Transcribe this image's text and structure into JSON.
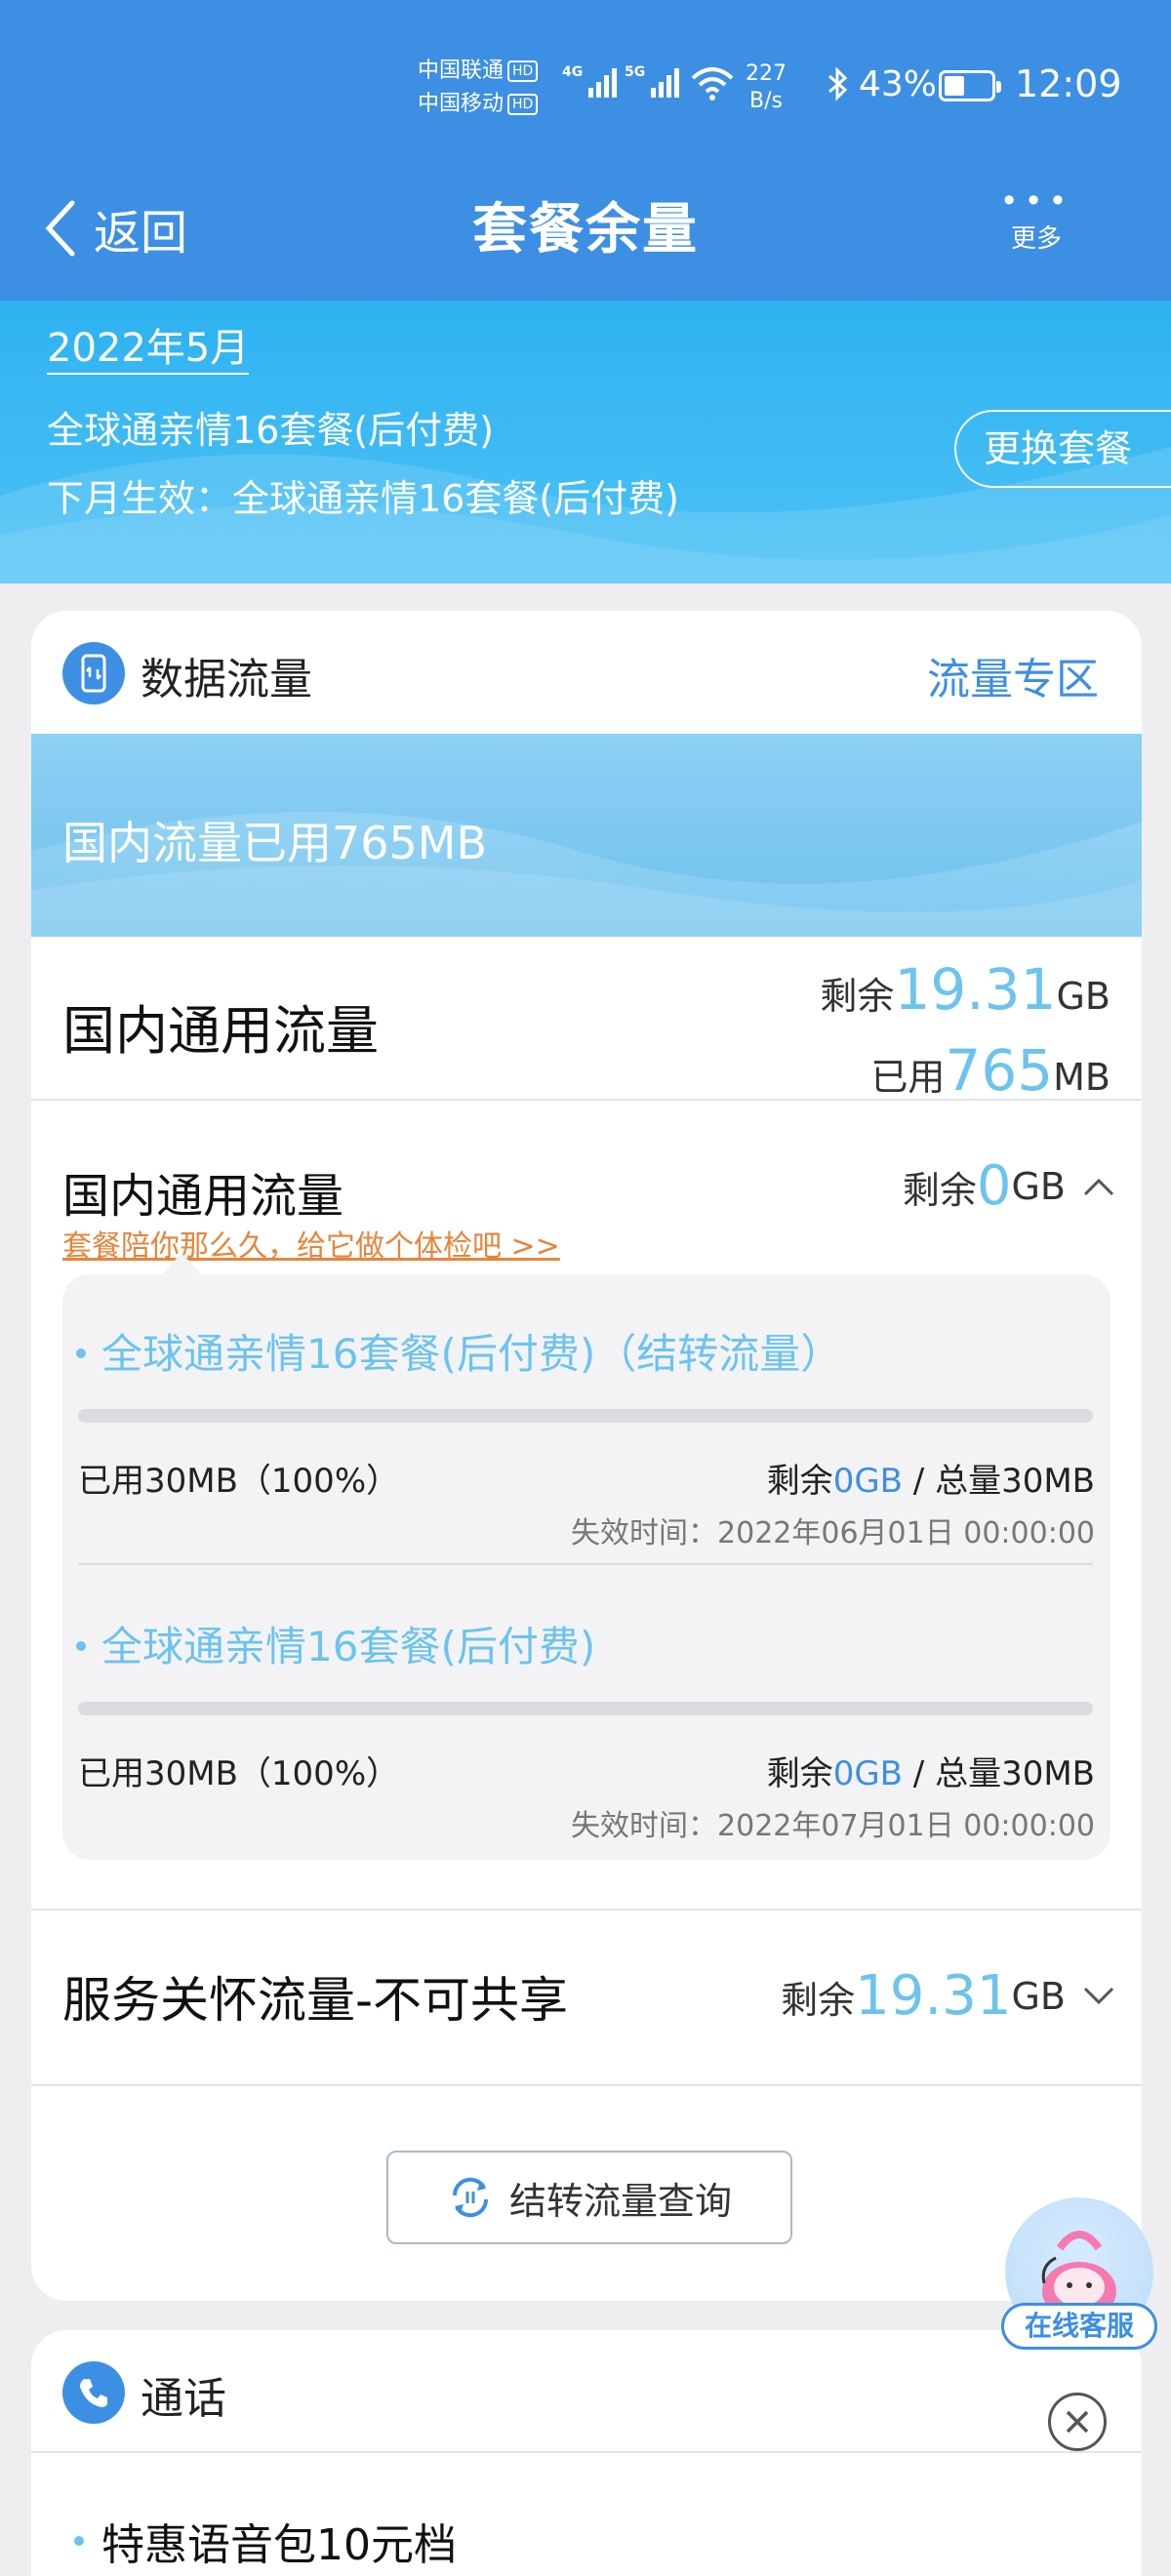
{
  "status_bar": {
    "carrier1": "中国联通",
    "carrier2": "中国移动",
    "hd": "HD",
    "net1": "4G",
    "net2": "5G",
    "speed_value": "227",
    "speed_unit": "B/s",
    "battery_pct": "43%",
    "battery_level": 0.43,
    "time": "12:09"
  },
  "navbar": {
    "back_label": "返回",
    "title": "套餐余量",
    "more_label": "更多"
  },
  "plan": {
    "month": "2022年5月",
    "name": "全球通亲情16套餐(后付费)",
    "next_month": "下月生效：全球通亲情16套餐(后付费)",
    "change_button": "更换套餐"
  },
  "data_card": {
    "title": "数据流量",
    "zone_link": "流量专区",
    "used_banner": "国内流量已用765MB",
    "general": {
      "label": "国内通用流量",
      "remain_prefix": "剩余",
      "remain_value": "19.31",
      "remain_unit": "GB",
      "used_prefix": "已用",
      "used_value": "765",
      "used_unit": "MB"
    },
    "general2": {
      "label": "国内通用流量",
      "checkup_link": "套餐陪你那么久，给它做个体检吧 >>",
      "remain_prefix": "剩余",
      "remain_value": "0",
      "remain_unit": "GB"
    },
    "packages": [
      {
        "name": "全球通亲情16套餐(后付费)（结转流量）",
        "used_pct": 1.0,
        "used": "已用30MB（100%）",
        "remain_prefix": "剩余",
        "remain_value": "0GB",
        "total": " / 总量30MB",
        "expire": "失效时间：2022年06月01日 00:00:00"
      },
      {
        "name": "全球通亲情16套餐(后付费)",
        "used_pct": 1.0,
        "used": "已用30MB（100%）",
        "remain_prefix": "剩余",
        "remain_value": "0GB",
        "total": " / 总量30MB",
        "expire": "失效时间：2022年07月01日 00:00:00"
      }
    ],
    "care": {
      "label": "服务关怀流量-不可共享",
      "remain_prefix": "剩余",
      "remain_value": "19.31",
      "remain_unit": "GB"
    },
    "rollover_button": "结转流量查询"
  },
  "call_card": {
    "title": "通话",
    "item": "特惠语音包10元档"
  },
  "customer_service": {
    "label": "在线客服"
  },
  "colors": {
    "nav_blue": "#3d8fe3",
    "plan_cyan": "#2fb2f1",
    "value_blue": "#6cc3ee",
    "checkup_orange": "#e8843a"
  }
}
